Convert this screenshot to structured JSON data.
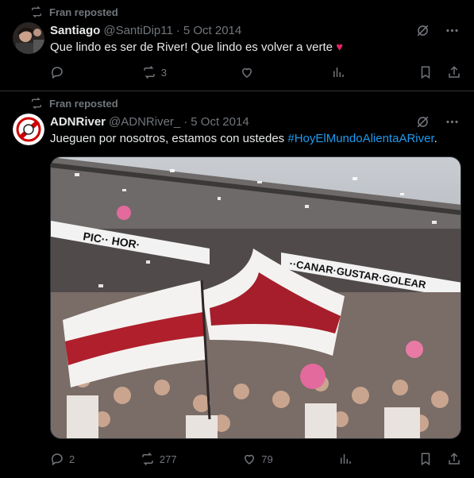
{
  "posts": [
    {
      "reposter": "Fran reposted",
      "name": "Santiago",
      "handle": "@SantiDip11",
      "separator": "·",
      "date": "5 Oct 2014",
      "text": "Que lindo es ser de River! Que lindo es volver a verte",
      "emoji": "♥",
      "replies": "",
      "reposts": "3",
      "likes": ""
    },
    {
      "reposter": "Fran reposted",
      "name": "ADNRiver",
      "handle": "@ADNRiver_",
      "separator": "·",
      "date": "5 Oct 2014",
      "text": "Jueguen por nosotros, estamos con ustedes ",
      "hashtag": "#HoyElMundoAlientaARiver",
      "text_end": ".",
      "replies": "2",
      "reposts": "277",
      "likes": "79",
      "image_banner": "PIC·· HOR· ··CANAR·GUSTAR·GOLEAR"
    }
  ],
  "colors": {
    "background": "#000000",
    "text": "#e7e9ea",
    "muted": "#71767b",
    "link": "#1d9bf0",
    "heart": "#e0245e"
  }
}
